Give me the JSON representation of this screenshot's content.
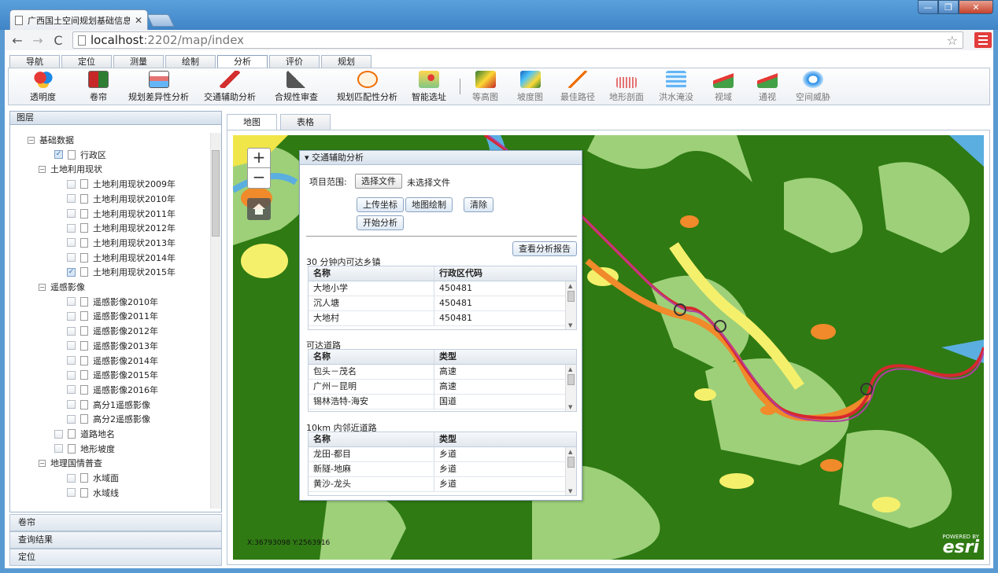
{
  "browser": {
    "tab_title": "广西国土空间规划基础信息",
    "url_host": "localhost",
    "url_path": ":2202/map/index"
  },
  "main_tabs": [
    "导航",
    "定位",
    "测量",
    "绘制",
    "分析",
    "评价",
    "规划"
  ],
  "tools": [
    "透明度",
    "卷帘",
    "规划差异性分析",
    "交通辅助分析",
    "合规性审查",
    "规划匹配性分析",
    "智能选址",
    "等高图",
    "坡度图",
    "最佳路径",
    "地形剖面",
    "洪水淹没",
    "视域",
    "通视",
    "空间威胁"
  ],
  "left_panel": {
    "title": "图层",
    "tree": [
      {
        "label": "基础数据",
        "level": 0,
        "expand": "−"
      },
      {
        "label": "行政区",
        "level": 2,
        "checked": true
      },
      {
        "label": "土地利用现状",
        "level": 1,
        "expand": "−"
      },
      {
        "label": "土地利用现状2009年",
        "level": 3,
        "checked": false
      },
      {
        "label": "土地利用现状2010年",
        "level": 3,
        "checked": false
      },
      {
        "label": "土地利用现状2011年",
        "level": 3,
        "checked": false
      },
      {
        "label": "土地利用现状2012年",
        "level": 3,
        "checked": false
      },
      {
        "label": "土地利用现状2013年",
        "level": 3,
        "checked": false
      },
      {
        "label": "土地利用现状2014年",
        "level": 3,
        "checked": false
      },
      {
        "label": "土地利用现状2015年",
        "level": 3,
        "checked": true
      },
      {
        "label": "遥感影像",
        "level": 1,
        "expand": "−"
      },
      {
        "label": "遥感影像2010年",
        "level": 3,
        "checked": false
      },
      {
        "label": "遥感影像2011年",
        "level": 3,
        "checked": false
      },
      {
        "label": "遥感影像2012年",
        "level": 3,
        "checked": false
      },
      {
        "label": "遥感影像2013年",
        "level": 3,
        "checked": false
      },
      {
        "label": "遥感影像2014年",
        "level": 3,
        "checked": false
      },
      {
        "label": "遥感影像2015年",
        "level": 3,
        "checked": false
      },
      {
        "label": "遥感影像2016年",
        "level": 3,
        "checked": false
      },
      {
        "label": "高分1遥感影像",
        "level": 3,
        "checked": false
      },
      {
        "label": "高分2遥感影像",
        "level": 3,
        "checked": false
      },
      {
        "label": "道路地名",
        "level": 2,
        "checked": false
      },
      {
        "label": "地形坡度",
        "level": 2,
        "checked": false
      },
      {
        "label": "地理国情普查",
        "level": 1,
        "expand": "−"
      },
      {
        "label": "水域面",
        "level": 3,
        "checked": false
      },
      {
        "label": "水域线",
        "level": 3,
        "checked": false
      }
    ],
    "accordions": [
      "卷帘",
      "查询结果",
      "定位"
    ]
  },
  "right_tabs": [
    "地图",
    "表格"
  ],
  "map": {
    "zoom_in": "+",
    "zoom_out": "−",
    "coords": "X:36793098 Y:2563916",
    "esri_powered": "POWERED BY",
    "esri_logo": "esri"
  },
  "panel": {
    "title": "交通辅助分析",
    "range_label": "项目范围:",
    "select_file": "选择文件",
    "no_file": "未选择文件",
    "upload_btn": "上传坐标",
    "draw_btn": "地图绘制",
    "clear_btn": "清除",
    "start_btn": "开始分析",
    "report_btn": "查看分析报告",
    "grid1": {
      "title": "30 分钟内可达乡镇",
      "h1": "名称",
      "h2": "行政区代码",
      "rows": [
        [
          "大地小学",
          "450481"
        ],
        [
          "沉人塘",
          "450481"
        ],
        [
          "大地村",
          "450481"
        ]
      ]
    },
    "grid2": {
      "title": "可达道路",
      "h1": "名称",
      "h2": "类型",
      "rows": [
        [
          "包头－茂名",
          "高速"
        ],
        [
          "广州－昆明",
          "高速"
        ],
        [
          "锡林浩特-海安",
          "国道"
        ]
      ]
    },
    "grid3": {
      "title": "10km 内邻近道路",
      "h1": "名称",
      "h2": "类型",
      "rows": [
        [
          "龙田-都目",
          "乡道"
        ],
        [
          "新隧-地麻",
          "乡道"
        ],
        [
          "黄沙-龙头",
          "乡道"
        ]
      ]
    }
  }
}
